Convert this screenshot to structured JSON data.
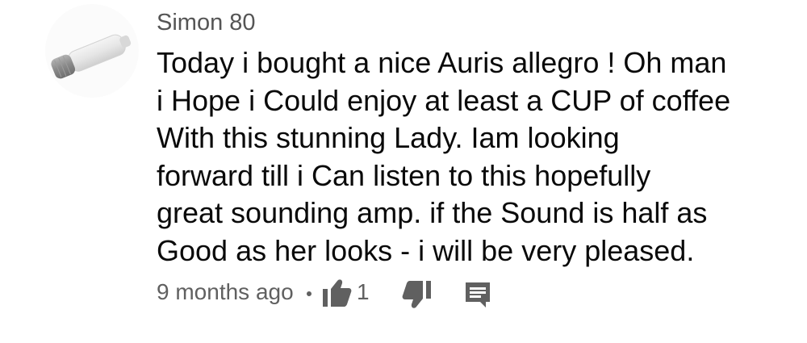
{
  "comment": {
    "author": "Simon 80",
    "avatar_icon": "amplifier-tube-avatar",
    "body_lines": [
      "Today i bought a nice Auris allegro ! Oh man",
      "i Hope i Could enjoy at least a CUP of coffee",
      "With this stunning Lady. Iam looking",
      "forward till i Can listen to this hopefully",
      "great sounding amp. if the Sound is half as",
      "Good as her looks - i will be very pleased."
    ],
    "timestamp": "9 months ago",
    "like_count": "1",
    "icons": {
      "like": "thumbs-up-icon",
      "dislike": "thumbs-down-icon",
      "reply": "reply-comment-icon"
    },
    "colors": {
      "text": "#0a0a0a",
      "meta": "#606060",
      "icon": "#606060"
    }
  }
}
